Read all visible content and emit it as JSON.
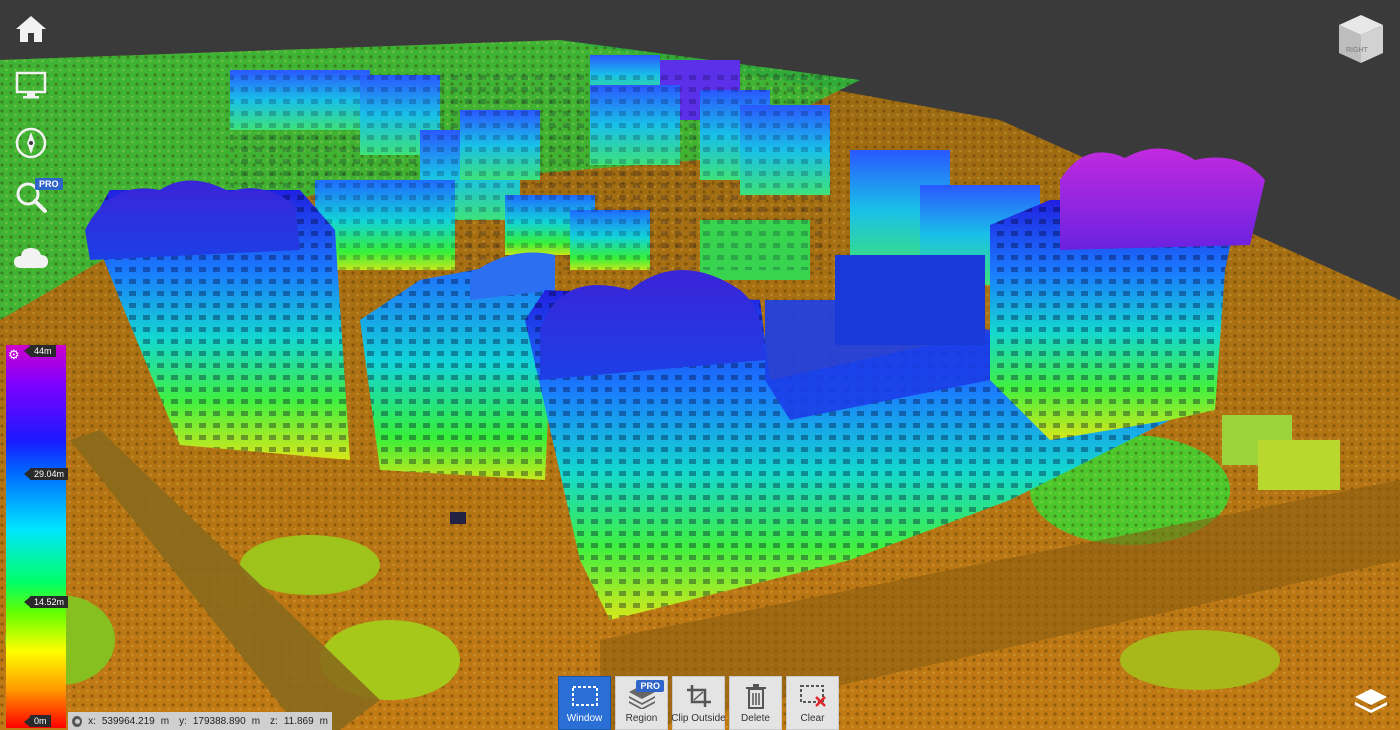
{
  "app": {
    "accent_color": "#2a6fd6",
    "badge_color": "#2f64c8",
    "background_color": "#3a3a3a"
  },
  "left_toolbar": [
    {
      "id": "home",
      "icon": "home-icon"
    },
    {
      "id": "view",
      "icon": "monitor-icon"
    },
    {
      "id": "navigate",
      "icon": "compass-icon"
    },
    {
      "id": "search",
      "icon": "magnifier-icon",
      "badge": "PRO"
    },
    {
      "id": "cloud",
      "icon": "cloud-icon"
    }
  ],
  "nav_cube": {
    "face_label": "RIGHT",
    "icon": "nav-cube-icon"
  },
  "color_scale": {
    "max_label": "44m",
    "upper_label": "29.04m",
    "lower_label": "14.52m",
    "min_label": "0m",
    "settings_icon": "gear-icon"
  },
  "coordinates": {
    "icon": "target-icon",
    "x_label": "x:",
    "x_value": "539964.219",
    "x_unit": "m",
    "y_label": "y:",
    "y_value": "179388.890",
    "y_unit": "m",
    "z_label": "z:",
    "z_value": "11.869",
    "z_unit": "m"
  },
  "tools": [
    {
      "id": "window",
      "label": "Window",
      "icon": "window-select-icon",
      "active": true
    },
    {
      "id": "region",
      "label": "Region",
      "icon": "layers-stack-icon",
      "badge": "PRO",
      "active": false
    },
    {
      "id": "clip-outside",
      "label": "Clip Outside",
      "icon": "crop-icon",
      "active": false
    },
    {
      "id": "delete",
      "label": "Delete",
      "icon": "trash-icon",
      "active": false
    },
    {
      "id": "clear",
      "label": "Clear",
      "icon": "clear-selection-icon",
      "active": false
    }
  ],
  "layers_button": {
    "icon": "layers-icon"
  }
}
